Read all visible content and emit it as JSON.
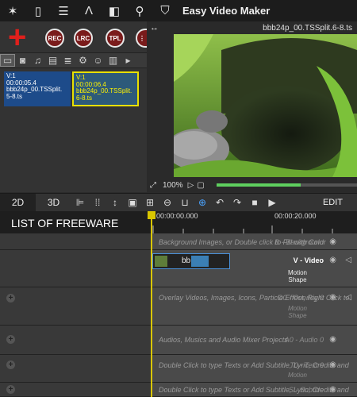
{
  "app": {
    "title": "Easy Video Maker"
  },
  "topbar": {
    "icons": [
      "wand-icon",
      "file-icon",
      "list-icon",
      "text-icon",
      "split-icon",
      "search-icon",
      "shirt-icon"
    ]
  },
  "buttons": {
    "rec": "REC",
    "lrc": "LRC",
    "tpl": "TPL"
  },
  "media": {
    "clips": [
      {
        "label": "V:1",
        "time": "00:00:05.4",
        "name": "bbb24p_00.TSSplit.",
        "name2": "5-8.ts"
      },
      {
        "label": "V:1",
        "time": "00:00:06.4",
        "name": "bbb24p_00.TSSplit.",
        "name2": "6-8.ts"
      }
    ]
  },
  "preview": {
    "title": "bbb24p_00.TSSplit.6-8.ts",
    "zoom": "100%",
    "progress": 0.6
  },
  "timeline": {
    "tabs": [
      "2D",
      "3D"
    ],
    "edit_label": "EDIT",
    "list_title": "LIST OF FREEWARE",
    "ruler": [
      "00:00:00.000",
      "00:00:20.000"
    ],
    "tracks": [
      {
        "name": "B - Background",
        "hint": "Background Images, or Double click to Fill with Color"
      },
      {
        "name": "V - Video",
        "sub1": "Motion",
        "sub2": "Shape",
        "clip_text": "bb"
      },
      {
        "name": "O0 - Overlay 0",
        "sub1": "Motion",
        "sub2": "Shape",
        "hint": "Overlay Videos, Images, Icons, Particle Effect, Right Click to"
      },
      {
        "name": "A0 - Audio 0",
        "hint": "Audios, Musics and Audio Mixer Projects"
      },
      {
        "name": "T0 - Text 0",
        "sub1": "Motion",
        "hint": "Double Click to type Texts or Add Subtitle, Lyric, Credits and"
      },
      {
        "name": "S - Subtitle",
        "hint": "Double Click to type Texts or Add Subtitle, Lyric, Credits and"
      }
    ]
  },
  "colors": {
    "accent": "#4aa3ff",
    "playhead": "#d9c600",
    "record": "#7a1b1b",
    "add": "#e0201c"
  }
}
